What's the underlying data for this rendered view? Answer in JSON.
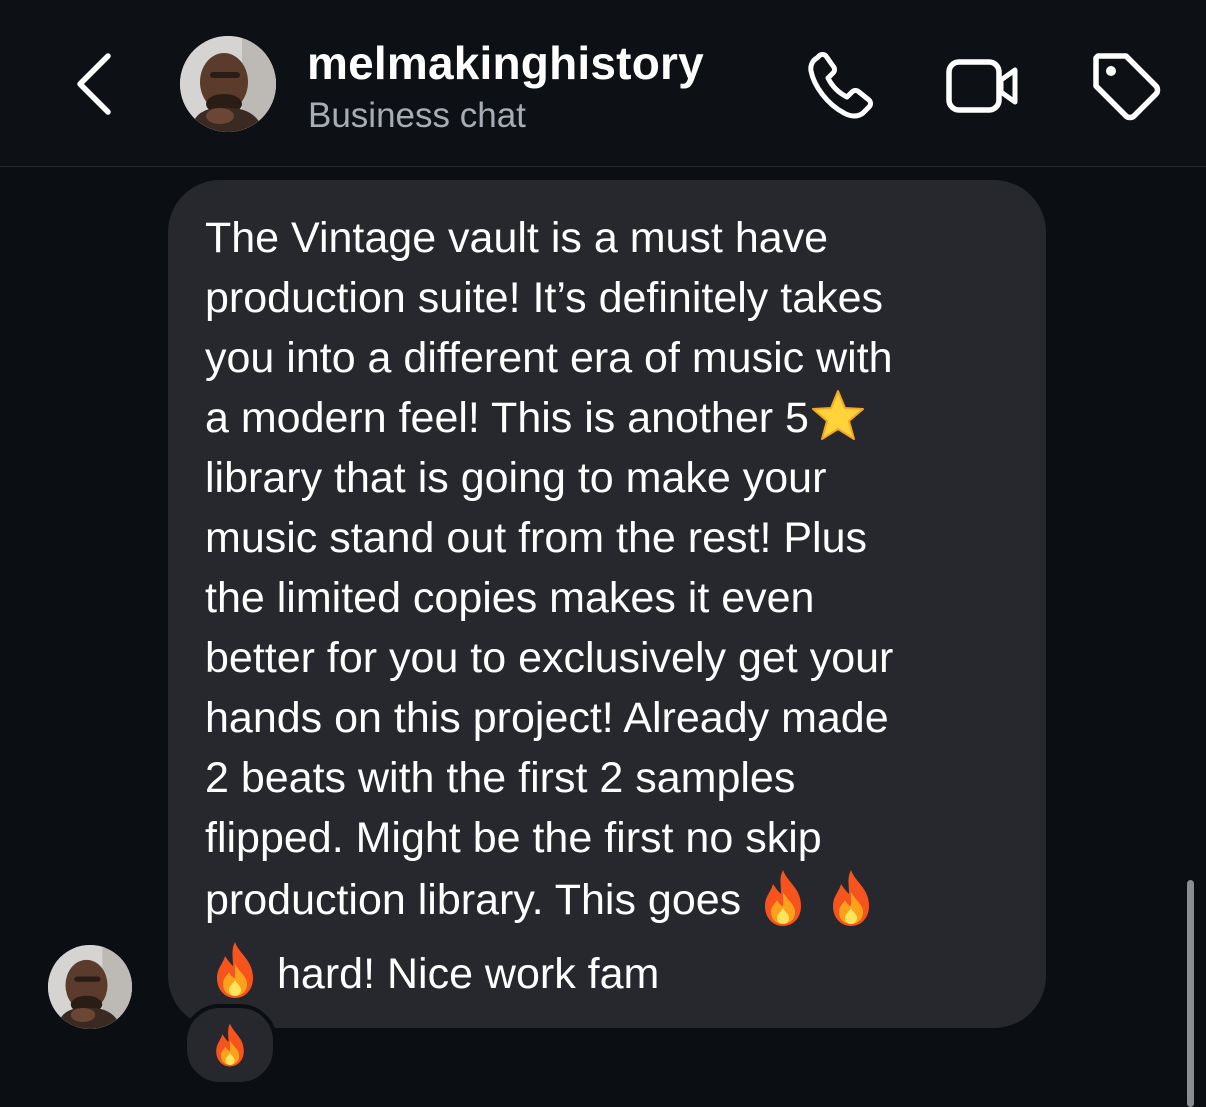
{
  "header": {
    "title": "melmakinghistory",
    "subtitle": "Business chat",
    "back_icon": "chevron-left-icon",
    "call_icon": "phone-icon",
    "video_icon": "video-camera-icon",
    "tag_icon": "tag-icon"
  },
  "message": {
    "lines": [
      "The Vintage vault is a must have",
      "production suite! It’s definitely takes",
      "you into a different era of music with",
      "a modern feel! This is another 5",
      "library that is going to make your",
      "music stand out from the rest! Plus",
      "the limited copies makes it even",
      "better for you to exclusively get your",
      "hands on this project! Already made",
      "2 beats with the first 2 samples",
      "flipped. Might be the first no skip",
      "production library. This goes",
      "hard! Nice work fam"
    ],
    "star_emoji": "star-emoji",
    "fire_emoji": "fire-emoji"
  },
  "reaction": {
    "emoji": "fire-emoji"
  },
  "colors": {
    "background": "#0b0e12",
    "bubble": "#26282d",
    "subtitle": "#a8adb5",
    "text": "#ffffff"
  }
}
